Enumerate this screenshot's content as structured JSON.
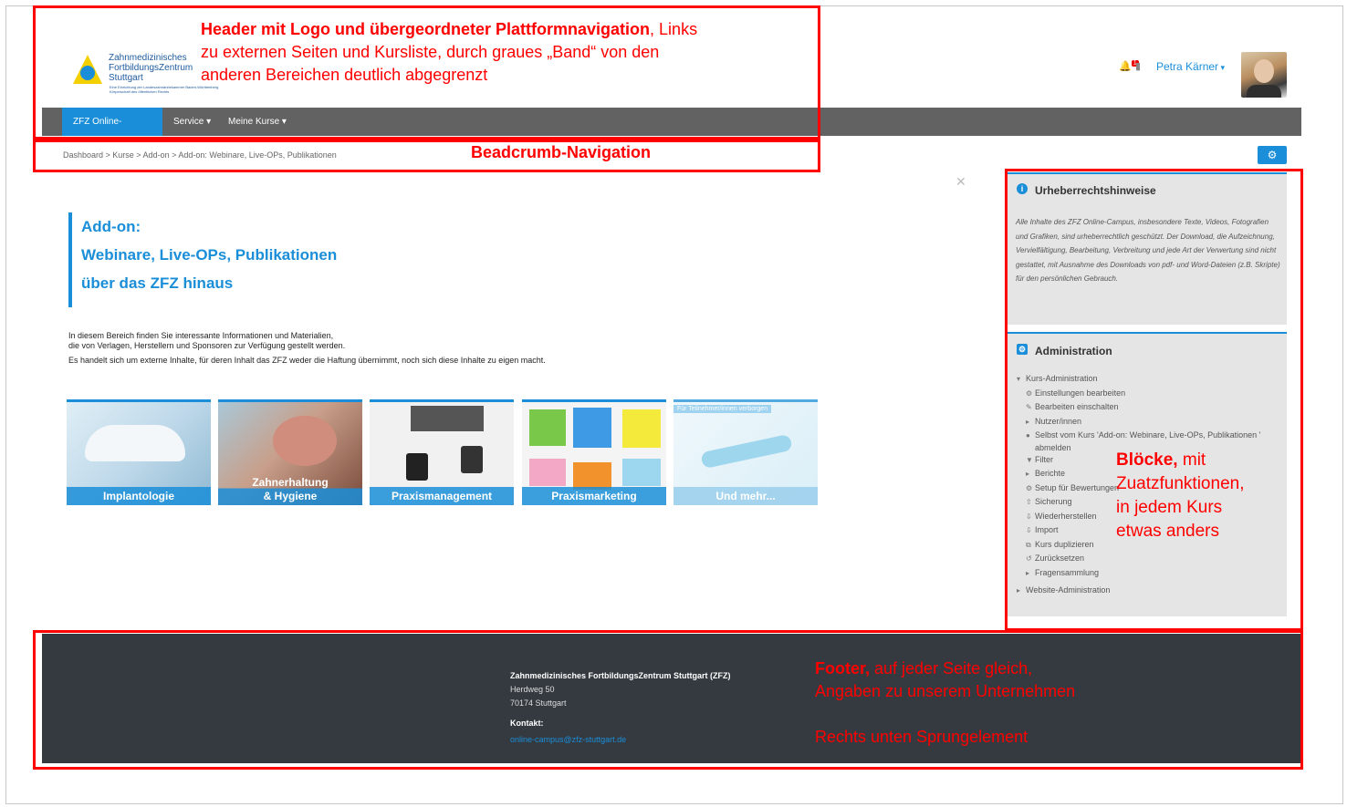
{
  "header": {
    "logo_line1": "Zahnmedizinisches",
    "logo_line2": "FortbildungsZentrum",
    "logo_line3": "Stuttgart",
    "logo_subline": "Eine Einrichtung der Landeszahnärztekammer Baden-Württemberg Körperschaft des öffentlichen Rechts",
    "user_name": "Petra Kärner",
    "notification_count": "1"
  },
  "nav": {
    "items": [
      {
        "label": "ZFZ Online-Campus",
        "active": true
      },
      {
        "label": "Service ▾"
      },
      {
        "label": "Meine Kurse ▾"
      }
    ]
  },
  "breadcrumb": "Dashboard > Kurse > Add-on > Add-on: Webinare, Live-OPs, Publikationen",
  "main": {
    "title_lines": [
      "Add-on:",
      "Webinare, Live-OPs, Publikationen",
      "über das ZFZ hinaus"
    ],
    "intro_lines": [
      "In diesem Bereich finden Sie interessante Informationen und Materialien,",
      "die von Verlagen, Herstellern und Sponsoren zur Verfügung gestellt werden.",
      "Es handelt sich um externe Inhalte, für deren Inhalt das ZFZ weder die Haftung übernimmt, noch sich diese Inhalte zu eigen macht."
    ],
    "tiles": [
      {
        "label": "Implantologie"
      },
      {
        "label_line1": "Zahnerhaltung",
        "label_line2": "& Hygiene"
      },
      {
        "label": "Praxismanagement"
      },
      {
        "label": "Praxismarketing"
      },
      {
        "label": "Und mehr...",
        "hidden_badge": "Für Teilnehmer/innen verborgen"
      }
    ]
  },
  "blocks": {
    "copyright": {
      "title": "Urheberrechtshinweise",
      "text": "Alle Inhalte des ZFZ Online-Campus, insbesondere Texte, Videos, Fotografien und Grafiken, sind urheberrechtlich geschützt. Der Download, die Aufzeichnung, Vervielfältigung, Bearbeitung, Verbreitung und jede Art der Verwertung sind nicht gestattet, mit Ausnahme des Downloads von pdf- und Word-Dateien (z.B. Skripte) für den persönlichen Gebrauch."
    },
    "admin": {
      "title": "Administration",
      "items": [
        "Kurs-Administration",
        "Einstellungen bearbeiten",
        "Bearbeiten einschalten",
        "Nutzer/innen",
        "Selbst vom Kurs 'Add-on: Webinare, Live-OPs, Publikationen '",
        "abmelden",
        "Filter",
        "Berichte",
        "Setup für Bewertungen",
        "Sicherung",
        "Wiederherstellen",
        "Import",
        "Kurs duplizieren",
        "Zurücksetzen",
        "Fragensammlung",
        "Website-Administration"
      ]
    }
  },
  "footer": {
    "org": "Zahnmedizinisches FortbildungsZentrum Stuttgart (ZFZ)",
    "street": "Herdweg 50",
    "city": "70174 Stuttgart",
    "contact_label": "Kontakt:",
    "email": "online-campus@zfz-stuttgart.de"
  },
  "annotations": {
    "header_bold": "Header mit Logo und übergeordneter Plattformnavigation",
    "header_rest_1": ", Links",
    "header_rest_2": "zu externen Seiten und Kursliste, durch graues „Band“ von den",
    "header_rest_3": "anderen Bereichen deutlich abgegrenzt",
    "breadcrumb": "Beadcrumb-Navigation",
    "blocks_bold": "Blöcke,",
    "blocks_rest_1": " mit",
    "blocks_rest_2": "Zuatzfunktionen,",
    "blocks_rest_3": "in jedem Kurs",
    "blocks_rest_4": "etwas anders",
    "footer_bold": "Footer,",
    "footer_rest_1": " auf jeder Seite gleich,",
    "footer_rest_2": "Angaben zu unserem Unternehmen",
    "footer_rest_3": "Rechts unten Sprungelement"
  }
}
